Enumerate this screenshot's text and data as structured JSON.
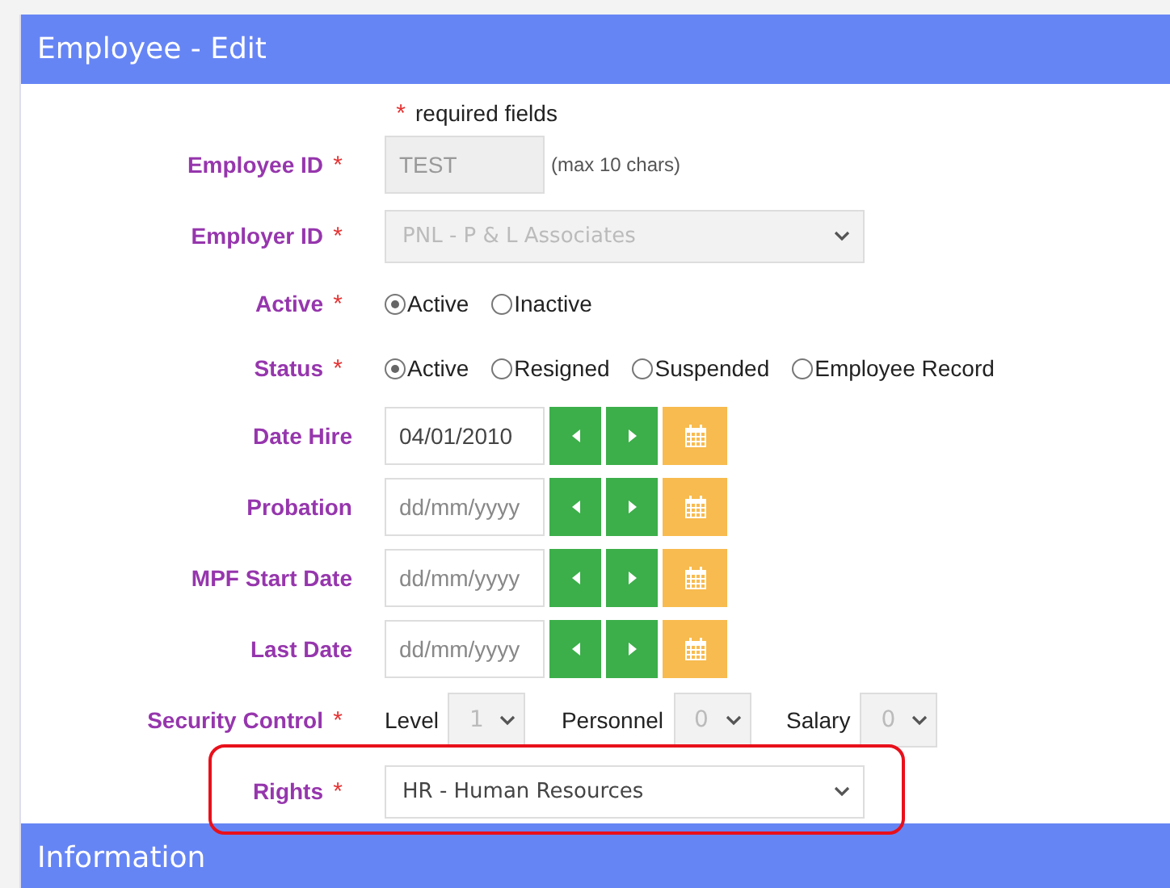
{
  "window": {
    "title": "Employee - Edit"
  },
  "required_note": {
    "mark": "*",
    "text": "required fields"
  },
  "fields": [
    {
      "kind": "text",
      "label": "Employee ID",
      "required_mark": "*",
      "value": "TEST",
      "disabled": true,
      "hint": "(max 10 chars)"
    },
    {
      "kind": "select",
      "label": "Employer ID",
      "required_mark": "*",
      "value": "PNL - P & L Associates",
      "disabled": true
    },
    {
      "kind": "radio",
      "label": "Active",
      "required_mark": "*",
      "options": [
        {
          "label": "Active",
          "selected": true
        },
        {
          "label": "Inactive",
          "selected": false
        }
      ]
    },
    {
      "kind": "radio",
      "label": "Status",
      "required_mark": "*",
      "options": [
        {
          "label": "Active",
          "selected": true
        },
        {
          "label": "Resigned",
          "selected": false
        },
        {
          "label": "Suspended",
          "selected": false
        },
        {
          "label": "Employee Record",
          "selected": false
        }
      ]
    },
    {
      "kind": "date",
      "label": "Date Hire",
      "value": "04/01/2010"
    },
    {
      "kind": "date",
      "label": "Probation",
      "placeholder": "dd/mm/yyyy"
    },
    {
      "kind": "date",
      "label": "MPF Start Date",
      "placeholder": "dd/mm/yyyy"
    },
    {
      "kind": "date",
      "label": "Last Date",
      "placeholder": "dd/mm/yyyy"
    },
    {
      "kind": "security",
      "label": "Security Control",
      "required_mark": "*",
      "selects": [
        {
          "label": "Level",
          "value": "1",
          "disabled": true
        },
        {
          "label": "Personnel",
          "value": "0",
          "disabled": true
        },
        {
          "label": "Salary",
          "value": "0",
          "disabled": true
        }
      ]
    },
    {
      "kind": "select",
      "label": "Rights",
      "required_mark": "*",
      "value": "HR - Human Resources",
      "disabled": false,
      "highlighted": true
    }
  ],
  "section": {
    "title": "Information"
  }
}
